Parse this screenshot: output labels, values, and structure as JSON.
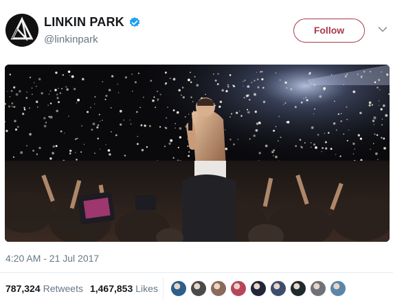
{
  "account": {
    "display_name": "LINKIN PARK",
    "handle": "@linkinpark",
    "verified_icon": "verified-badge-icon",
    "avatar_icon": "linkin-park-logo"
  },
  "actions": {
    "follow_label": "Follow",
    "menu_icon": "chevron-down-icon"
  },
  "media": {
    "kind": "concert-photo"
  },
  "tweet": {
    "timestamp": "4:20 AM - 21 Jul 2017"
  },
  "stats": {
    "retweets_count": "787,324",
    "retweets_label": "Retweets",
    "likes_count": "1,467,853",
    "likes_label": "Likes"
  },
  "likers": [
    {
      "color": "#2d5f8a"
    },
    {
      "color": "#4a4a4a"
    },
    {
      "color": "#8a6a5a"
    },
    {
      "color": "#b8465a"
    },
    {
      "color": "#222638"
    },
    {
      "color": "#3c4e6b"
    },
    {
      "color": "#1f2a2f"
    },
    {
      "color": "#6f7378"
    },
    {
      "color": "#5b86a8"
    }
  ],
  "colors": {
    "follow_accent": "#a8394c",
    "verified_blue": "#1da1f2",
    "muted_text": "#657786"
  }
}
